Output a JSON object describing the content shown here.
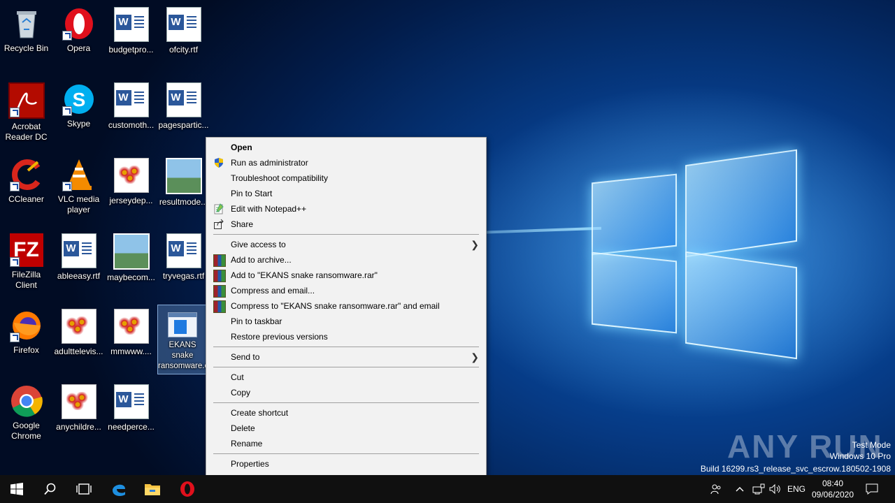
{
  "desktop": {
    "icons": [
      {
        "label": "Recycle Bin",
        "name": "recycle-bin-icon"
      },
      {
        "label": "Opera",
        "name": "opera-icon"
      },
      {
        "label": "budgetpro...",
        "name": "word-document-icon"
      },
      {
        "label": "ofcity.rtf",
        "name": "word-document-icon"
      },
      {
        "label": "Acrobat Reader DC",
        "name": "acrobat-reader-icon"
      },
      {
        "label": "Skype",
        "name": "skype-icon"
      },
      {
        "label": "customoth...",
        "name": "word-document-icon"
      },
      {
        "label": "pagespartic...",
        "name": "word-document-icon"
      },
      {
        "label": "CCleaner",
        "name": "ccleaner-icon"
      },
      {
        "label": "VLC media player",
        "name": "vlc-icon"
      },
      {
        "label": "jerseydep...",
        "name": "image-file-icon"
      },
      {
        "label": "resultmode...",
        "name": "image-file-icon"
      },
      {
        "label": "FileZilla Client",
        "name": "filezilla-icon"
      },
      {
        "label": "ableeasy.rtf",
        "name": "word-document-icon"
      },
      {
        "label": "maybecom...",
        "name": "image-file-icon"
      },
      {
        "label": "tryvegas.rtf",
        "name": "word-document-icon"
      },
      {
        "label": "Firefox",
        "name": "firefox-icon"
      },
      {
        "label": "adulttelevis...",
        "name": "image-file-icon"
      },
      {
        "label": "mmwww....",
        "name": "image-file-icon"
      },
      {
        "label": "EKANS snake ransomware.exe",
        "name": "executable-icon"
      },
      {
        "label": "Google Chrome",
        "name": "chrome-icon"
      },
      {
        "label": "anychildre...",
        "name": "image-file-icon"
      },
      {
        "label": "needperce...",
        "name": "word-document-icon"
      }
    ]
  },
  "context_menu": {
    "items": [
      {
        "label": "Open"
      },
      {
        "label": "Run as administrator",
        "icon": "uac-shield-icon"
      },
      {
        "label": "Troubleshoot compatibility"
      },
      {
        "label": "Pin to Start"
      },
      {
        "label": "Edit with Notepad++",
        "icon": "notepadpp-icon"
      },
      {
        "label": "Share",
        "icon": "share-icon"
      },
      {
        "label": "Give access to",
        "submenu": true
      },
      {
        "label": "Add to archive...",
        "icon": "winrar-icon"
      },
      {
        "label": "Add to \"EKANS snake ransomware.rar\"",
        "icon": "winrar-icon"
      },
      {
        "label": "Compress and email...",
        "icon": "winrar-icon"
      },
      {
        "label": "Compress to \"EKANS snake ransomware.rar\" and email",
        "icon": "winrar-icon"
      },
      {
        "label": "Pin to taskbar"
      },
      {
        "label": "Restore previous versions"
      },
      {
        "label": "Send to",
        "submenu": true
      },
      {
        "label": "Cut"
      },
      {
        "label": "Copy"
      },
      {
        "label": "Create shortcut"
      },
      {
        "label": "Delete"
      },
      {
        "label": "Rename"
      },
      {
        "label": "Properties"
      }
    ]
  },
  "watermark": {
    "brand": "ANY RUN",
    "line1": "Test Mode",
    "line2": "Windows 10 Pro",
    "line3": "Build 16299.rs3_release_svc_escrow.180502-1908"
  },
  "taskbar": {
    "language": "ENG",
    "time": "08:40",
    "date": "09/06/2020"
  },
  "colors": {
    "taskbar_bg": "#101010",
    "menu_bg": "#f2f2f2",
    "word_blue": "#2b579a"
  }
}
